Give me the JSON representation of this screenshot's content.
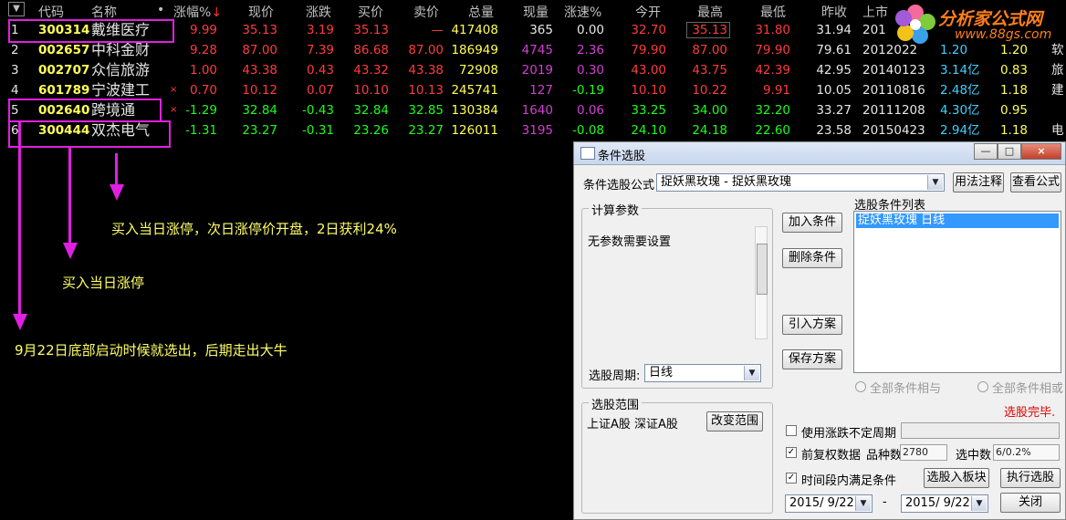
{
  "table": {
    "menu_toggle": "▼",
    "headers": [
      "代码",
      "名称",
      "•",
      "涨幅%",
      "现价",
      "涨跌",
      "买价",
      "卖价",
      "总量",
      "现量",
      "涨速%",
      "今开",
      "最高",
      "最低",
      "昨收",
      "上市"
    ],
    "sort_indicator": "↓",
    "rows": [
      {
        "idx": "1",
        "code": "300314",
        "name": "戴维医疗",
        "mark": "",
        "chg_pct": "9.99",
        "price": "35.13",
        "chg": "3.19",
        "bid": "35.13",
        "ask": "—",
        "vol": "417408",
        "cur_vol": "365",
        "speed": "0.00",
        "open": "32.70",
        "high": "35.13",
        "low": "31.80",
        "prev": "31.94",
        "list_date": "201",
        "shares": "",
        "pe": "",
        "ind": ""
      },
      {
        "idx": "2",
        "code": "002657",
        "name": "中科金财",
        "mark": "",
        "chg_pct": "9.28",
        "price": "87.00",
        "chg": "7.39",
        "bid": "86.68",
        "ask": "87.00",
        "vol": "186949",
        "cur_vol": "4745",
        "speed": "2.36",
        "open": "79.90",
        "high": "87.00",
        "low": "79.90",
        "prev": "79.61",
        "list_date": "2012022",
        "shares": "1.20",
        "pe": "1.20",
        "ind": "软"
      },
      {
        "idx": "3",
        "code": "002707",
        "name": "众信旅游",
        "mark": "",
        "chg_pct": "1.00",
        "price": "43.38",
        "chg": "0.43",
        "bid": "43.32",
        "ask": "43.38",
        "vol": "72908",
        "cur_vol": "2019",
        "speed": "0.30",
        "open": "43.00",
        "high": "43.75",
        "low": "42.39",
        "prev": "42.95",
        "list_date": "20140123",
        "shares": "3.14亿",
        "pe": "0.83",
        "ind": "旅"
      },
      {
        "idx": "4",
        "code": "601789",
        "name": "宁波建工",
        "mark": "×",
        "chg_pct": "0.70",
        "price": "10.12",
        "chg": "0.07",
        "bid": "10.10",
        "ask": "10.13",
        "vol": "245741",
        "cur_vol": "127",
        "speed": "-0.19",
        "open": "10.10",
        "high": "10.22",
        "low": "9.91",
        "prev": "10.05",
        "list_date": "20110816",
        "shares": "2.48亿",
        "pe": "1.18",
        "ind": "建"
      },
      {
        "idx": "5",
        "code": "002640",
        "name": "跨境通",
        "mark": "×",
        "chg_pct": "-1.29",
        "price": "32.84",
        "chg": "-0.43",
        "bid": "32.84",
        "ask": "32.85",
        "vol": "130384",
        "cur_vol": "1640",
        "speed": "0.06",
        "open": "33.25",
        "high": "34.00",
        "low": "32.20",
        "prev": "33.27",
        "list_date": "20111208",
        "shares": "4.30亿",
        "pe": "0.95",
        "ind": ""
      },
      {
        "idx": "6",
        "code": "300444",
        "name": "双杰电气",
        "mark": "",
        "chg_pct": "-1.31",
        "price": "23.27",
        "chg": "-0.31",
        "bid": "23.26",
        "ask": "23.27",
        "vol": "126011",
        "cur_vol": "3195",
        "speed": "-0.08",
        "open": "24.10",
        "high": "24.18",
        "low": "22.60",
        "prev": "23.58",
        "list_date": "20150423",
        "shares": "2.94亿",
        "pe": "1.18",
        "ind": "电"
      }
    ]
  },
  "logo": {
    "name": "分析家公式网",
    "url": "www.88gs.com"
  },
  "annotations": {
    "a1": "买入当日涨停，次日涨停价开盘，2日获利24%",
    "a2": "买入当日涨停",
    "a3": "9月22日底部启动时候就选出，后期走出大牛"
  },
  "dialog": {
    "title": "条件选股",
    "formula_label": "条件选股公式",
    "formula_value": "捉妖黑玫瑰   - 捉妖黑玫瑰",
    "usage_btn": "用法注释",
    "view_btn": "查看公式",
    "params_group": "计算参数",
    "params_text": "无参数需要设置",
    "add_btn": "加入条件",
    "delete_btn": "删除条件",
    "import_btn": "引入方案",
    "save_btn": "保存方案",
    "cond_list_label": "选股条件列表",
    "cond_list_items": [
      "捉妖黑玫瑰  日线"
    ],
    "period_label": "选股周期:",
    "period_value": "日线",
    "radio_all_and": "全部条件相与",
    "radio_all_or": "全部条件相或",
    "done_text": "选股完毕.",
    "range_group": "选股范围",
    "range_value": "上证A股 深证A股",
    "change_range_btn": "改变范围",
    "chk_variable_period": "使用涨跌不定周期",
    "chk_adjusted": "前复权数据",
    "varieties_label": "品种数",
    "varieties_value": "2780",
    "selected_label": "选中数",
    "selected_value": "6/0.2%",
    "chk_time_range": "时间段内满足条件",
    "to_board_btn": "选股入板块",
    "execute_btn": "执行选股",
    "date_from": "2015/ 9/22",
    "date_sep": "-",
    "date_to": "2015/ 9/22",
    "close_btn": "关闭",
    "win_min": "—",
    "win_max": "□",
    "win_close": "×"
  }
}
